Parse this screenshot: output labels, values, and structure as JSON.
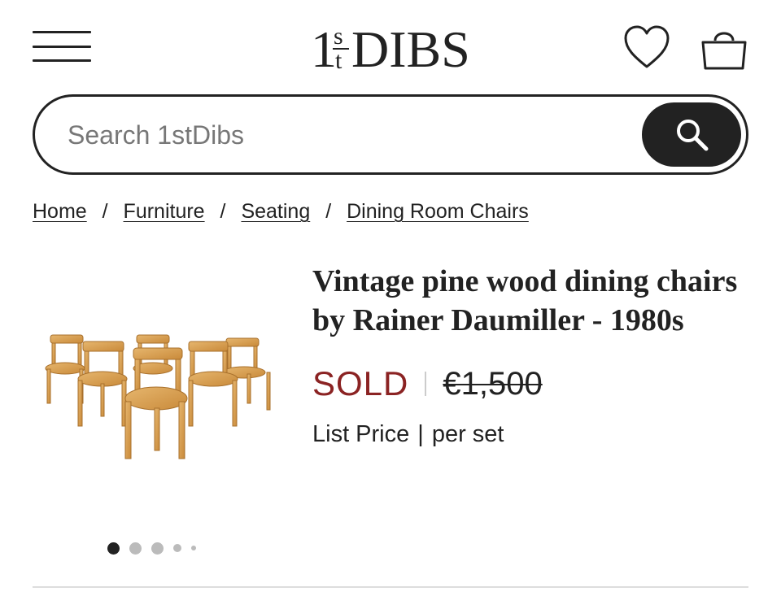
{
  "header": {
    "logo_text": "1stDIBS",
    "menu_icon": "hamburger-menu-icon",
    "favorites_icon": "heart-icon",
    "bag_icon": "shopping-bag-icon"
  },
  "search": {
    "placeholder": "Search 1stDibs",
    "button_icon": "search-icon"
  },
  "breadcrumb": [
    {
      "label": "Home"
    },
    {
      "label": "Furniture"
    },
    {
      "label": "Seating"
    },
    {
      "label": "Dining Room Chairs"
    }
  ],
  "breadcrumb_separator": "/",
  "product": {
    "title": "Vintage pine wood dining chairs by Rainer Daumiller - 1980s",
    "status": "SOLD",
    "original_price": "€1,500",
    "price_note": {
      "label": "List Price",
      "separator": "|",
      "unit": "per set"
    },
    "image_alt": "six-pine-chairs-photo"
  },
  "carousel": {
    "dot_count": 5,
    "active_index": 0
  },
  "colors": {
    "text": "#222222",
    "sold": "#8b2323",
    "placeholder": "#777777",
    "button": "#222222"
  }
}
